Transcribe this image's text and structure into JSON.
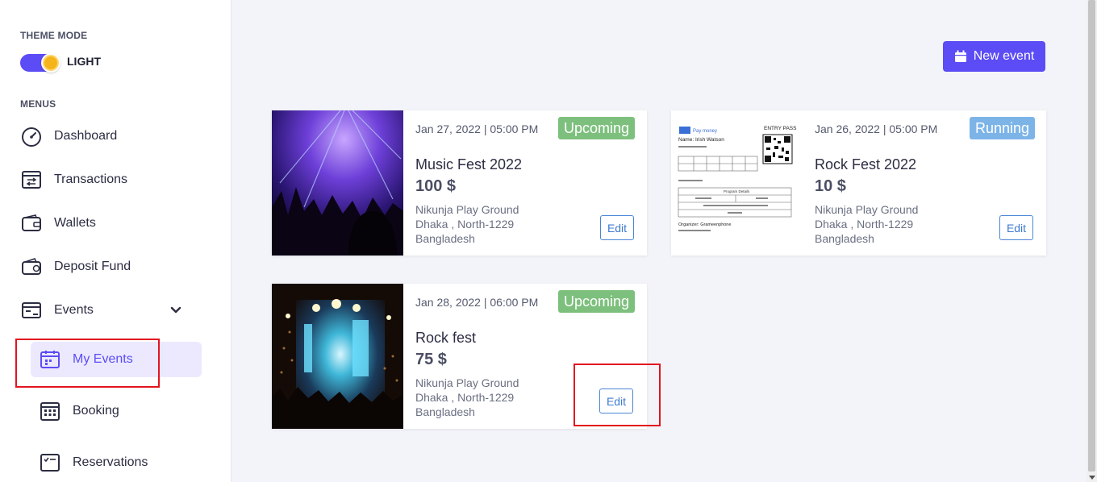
{
  "sidebar": {
    "theme_mode_label": "THEME MODE",
    "theme_toggle_text": "LIGHT",
    "menus_label": "MENUS",
    "items": [
      {
        "label": "Dashboard",
        "icon": "dashboard-icon"
      },
      {
        "label": "Transactions",
        "icon": "transactions-icon"
      },
      {
        "label": "Wallets",
        "icon": "wallet-icon"
      },
      {
        "label": "Deposit Fund",
        "icon": "deposit-fund-icon"
      },
      {
        "label": "Events",
        "icon": "events-icon"
      }
    ],
    "sub_items": [
      {
        "label": "My Events",
        "icon": "my-events-icon",
        "active": true
      },
      {
        "label": "Booking",
        "icon": "booking-icon"
      },
      {
        "label": "Reservations",
        "icon": "reservations-icon"
      }
    ]
  },
  "main": {
    "new_event_label": "New event",
    "events": [
      {
        "date": "Jan 27, 2022 | 05:00 PM",
        "status": "Upcoming",
        "title": "Music Fest 2022",
        "price": "100 $",
        "venue": "Nikunja Play Ground",
        "city": "Dhaka , North-1229",
        "country": "Bangladesh",
        "edit_label": "Edit"
      },
      {
        "date": "Jan 26, 2022 | 05:00 PM",
        "status": "Running",
        "title": "Rock Fest 2022",
        "price": "10 $",
        "venue": "Nikunja Play Ground",
        "city": "Dhaka , North-1229",
        "country": "Bangladesh",
        "edit_label": "Edit"
      },
      {
        "date": "Jan 28, 2022 | 06:00 PM",
        "status": "Upcoming",
        "title": "Rock fest",
        "price": "75 $",
        "venue": "Nikunja Play Ground",
        "city": "Dhaka , North-1229",
        "country": "Bangladesh",
        "edit_label": "Edit"
      }
    ],
    "ticket_preview": {
      "brand": "Pay money",
      "heading": "ENTRY PASS",
      "name": "Name: Irish Watson",
      "section": "Program Details",
      "organizer": "Organizer: Grameenphone"
    }
  },
  "colors": {
    "accent": "#5b4cf5",
    "upcoming": "#7dc07d",
    "running": "#7cb4e8",
    "highlight": "#e3141f"
  }
}
